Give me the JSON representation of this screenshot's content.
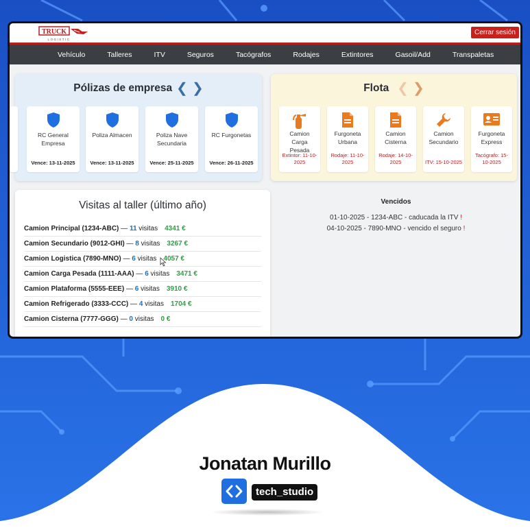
{
  "brand_colors": {
    "accent_red": "#c8201d",
    "link_blue": "#1f6fb5",
    "money_green": "#2f9e44",
    "navbar": "#3b3f44"
  },
  "header": {
    "logo_text": "TRUCK",
    "logo_sub": "LOGISTIC",
    "logout_label": "Cerrar sesión"
  },
  "nav": {
    "items": [
      "Vehículo",
      "Talleres",
      "ITV",
      "Seguros",
      "Tacógrafos",
      "Rodajes",
      "Extintores",
      "Gasoil/Add",
      "Transpaletas"
    ]
  },
  "policies": {
    "title": "Pólizas de empresa",
    "prev_icon": "chevron-left-icon",
    "next_icon": "chevron-right-icon",
    "items": [
      {
        "name": "RC General Empresa",
        "due": "Vence: 13-11-2025",
        "icon": "shield-icon"
      },
      {
        "name": "Poliza Almacen",
        "due": "Vence: 13-11-2025",
        "icon": "shield-icon"
      },
      {
        "name": "Poliza Nave Secundaria",
        "due": "Vence: 25-11-2025",
        "icon": "shield-icon"
      },
      {
        "name": "RC Furgonetas",
        "due": "Vence: 26-11-2025",
        "icon": "shield-icon"
      }
    ]
  },
  "fleet": {
    "title": "Flota",
    "items": [
      {
        "name": "Camion Carga Pesada",
        "alert": "Extintor: 11-10-2025",
        "icon": "fire-extinguisher-icon"
      },
      {
        "name": "Furgoneta Urbana",
        "alert": "Rodaje: 11-10-2025",
        "icon": "document-icon"
      },
      {
        "name": "Camion Cisterna",
        "alert": "Rodaje: 14-10-2025",
        "icon": "document-icon"
      },
      {
        "name": "Camion Secundario",
        "alert": "ITV: 15-10-2025",
        "icon": "wrench-icon"
      },
      {
        "name": "Furgoneta Express",
        "alert": "Tacógrafo: 15-10-2025",
        "icon": "id-card-icon"
      }
    ]
  },
  "visits": {
    "title": "Visitas al taller (último año)",
    "sep": "—",
    "unit": "visitas",
    "rows": [
      {
        "vehicle": "Camion Principal (1234-ABC)",
        "count": "11",
        "cost": "4341 €"
      },
      {
        "vehicle": "Camion Secundario (9012-GHI)",
        "count": "8",
        "cost": "3267 €"
      },
      {
        "vehicle": "Camion Logistica (7890-MNO)",
        "count": "6",
        "cost": "4057 €"
      },
      {
        "vehicle": "Camion Carga Pesada (1111-AAA)",
        "count": "6",
        "cost": "3471 €"
      },
      {
        "vehicle": "Camion Plataforma (5555-EEE)",
        "count": "6",
        "cost": "3910 €"
      },
      {
        "vehicle": "Camion Refrigerado (3333-CCC)",
        "count": "4",
        "cost": "1704 €"
      },
      {
        "vehicle": "Camion Cisterna (7777-GGG)",
        "count": "0",
        "cost": "0 €"
      }
    ]
  },
  "expired": {
    "title": "Vencidos",
    "items": [
      {
        "text": "01-10-2025 - 1234-ABC - caducada la ITV",
        "mark": "!"
      },
      {
        "text": "04-10-2025 - 7890-MNO - vencido el seguro",
        "mark": "!"
      }
    ]
  },
  "footer": {
    "name": "Jonatan Murillo",
    "tag": "tech_studio",
    "icon": "code-brackets-icon"
  }
}
